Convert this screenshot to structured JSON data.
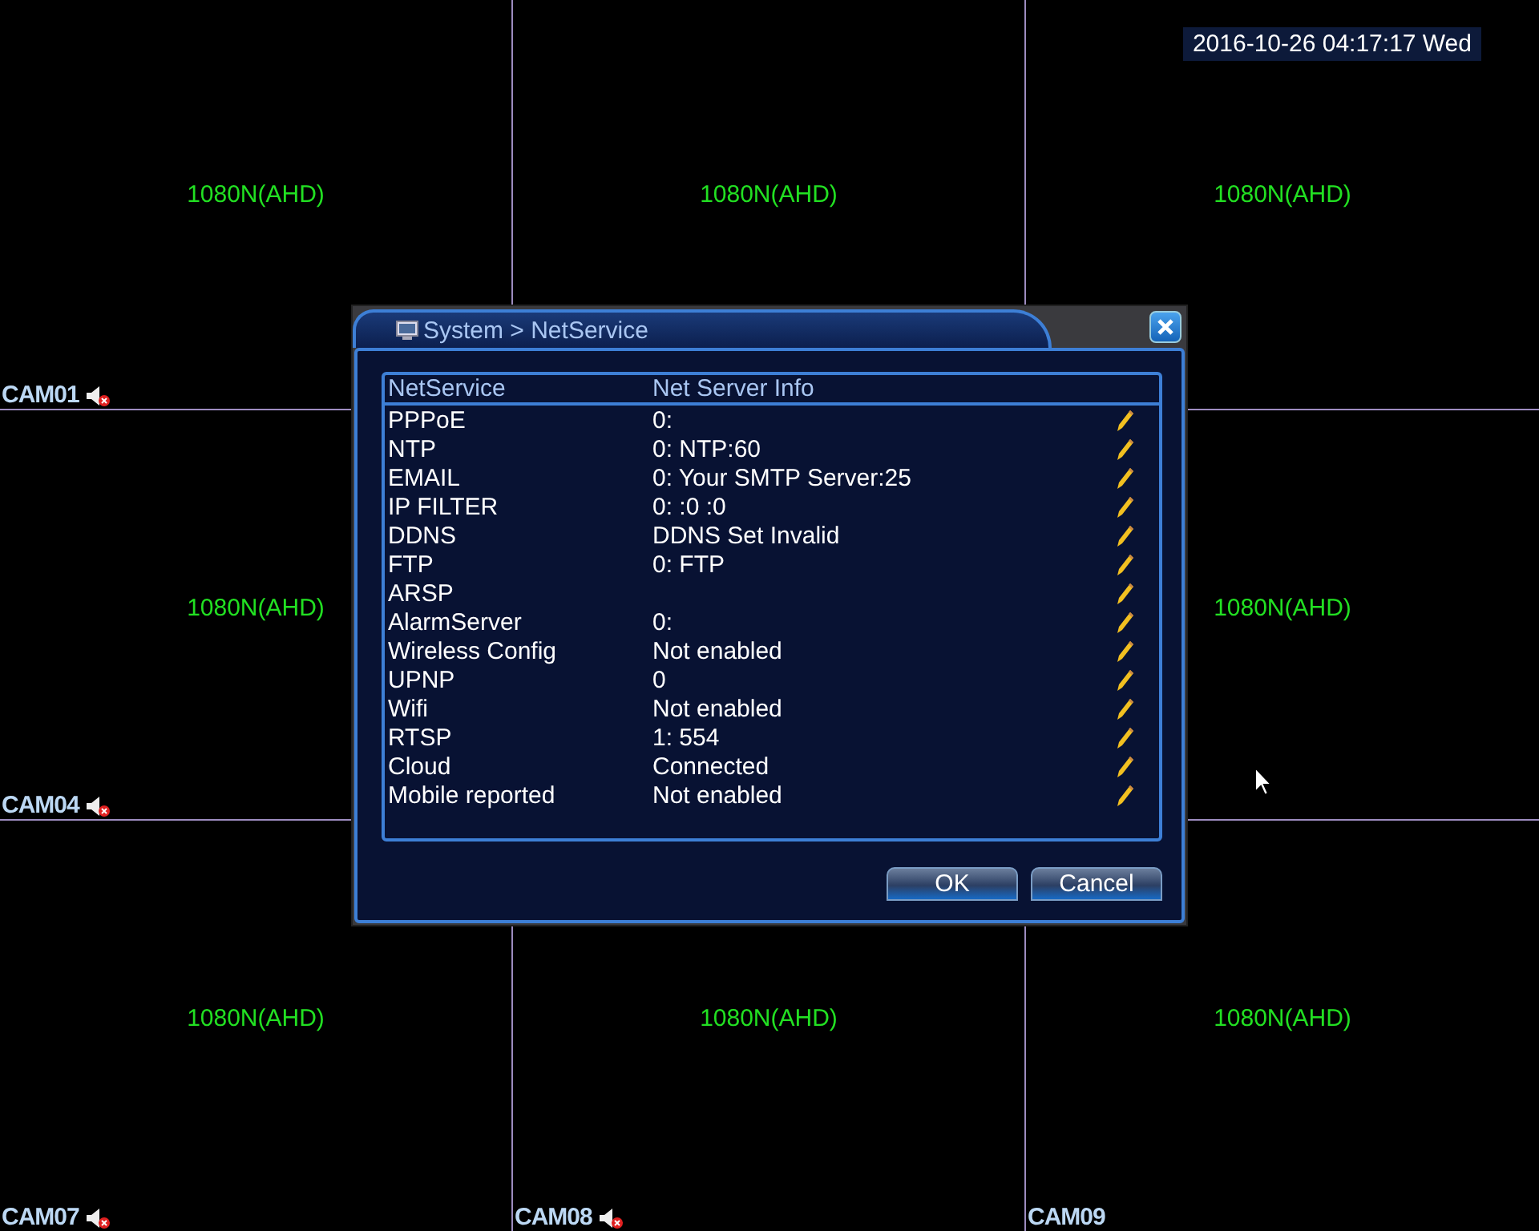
{
  "clock": "2016-10-26 04:17:17 Wed",
  "tiles": [
    {
      "resolution": "1080N(AHD)",
      "label": "CAM01",
      "muted": true
    },
    {
      "resolution": "1080N(AHD)"
    },
    {
      "resolution": "1080N(AHD)"
    },
    {
      "resolution": "1080N(AHD)",
      "label": "CAM04",
      "muted": true
    },
    {
      "resolution": "1080N(AHD)"
    },
    {
      "resolution": "1080N(AHD)",
      "label": "CAM07",
      "muted": true
    },
    {
      "resolution": "1080N(AHD)",
      "label": "CAM08",
      "muted": true
    },
    {
      "resolution": "1080N(AHD)",
      "label": "CAM09",
      "muted": false
    }
  ],
  "dialog": {
    "title": "System > NetService",
    "columns": [
      "NetService",
      "Net Server Info"
    ],
    "rows": [
      {
        "service": "PPPoE",
        "info": "0:"
      },
      {
        "service": "NTP",
        "info": "0: NTP:60"
      },
      {
        "service": "EMAIL",
        "info": "0: Your SMTP Server:25"
      },
      {
        "service": "IP FILTER",
        "info": "0: :0 :0"
      },
      {
        "service": "DDNS",
        "info": "DDNS Set Invalid"
      },
      {
        "service": "FTP",
        "info": "0: FTP"
      },
      {
        "service": "ARSP"
      },
      {
        "service": "AlarmServer",
        "info": "0:"
      },
      {
        "service": "Wireless Config",
        "info": "Not enabled"
      },
      {
        "service": "UPNP",
        "info": "0"
      },
      {
        "service": "Wifi",
        "info": "Not enabled"
      },
      {
        "service": "RTSP",
        "info": "1: 554"
      },
      {
        "service": "Cloud",
        "info": "Connected"
      },
      {
        "service": "Mobile reported",
        "info": "Not enabled"
      }
    ],
    "buttons": [
      "OK",
      "Cancel"
    ]
  }
}
